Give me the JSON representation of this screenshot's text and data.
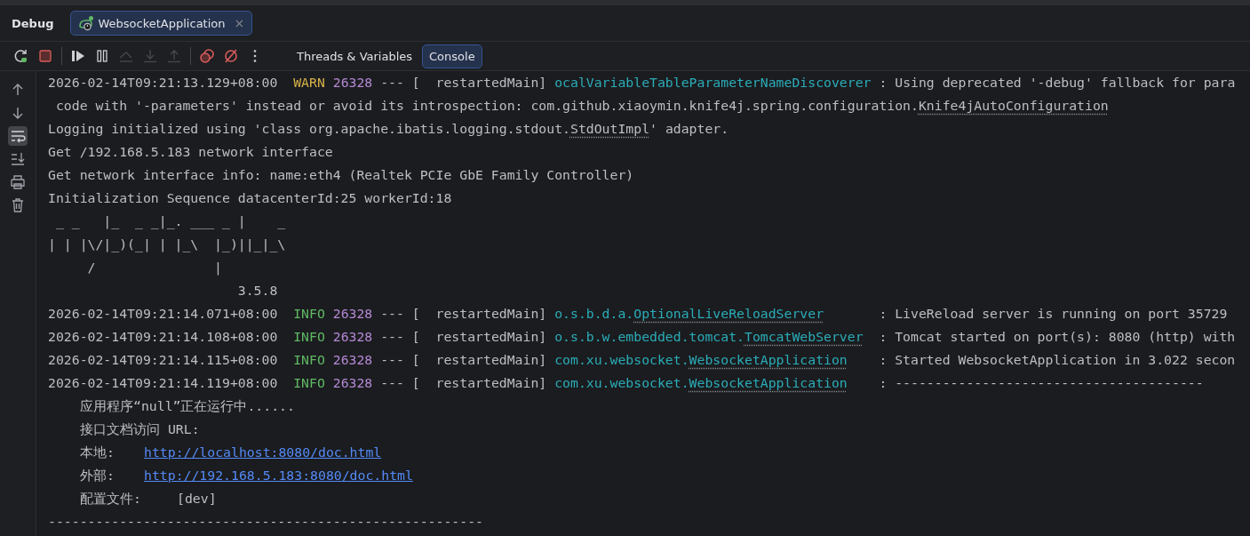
{
  "panel": {
    "title": "Debug",
    "session_tab": {
      "label": "WebsocketApplication",
      "close": "×",
      "selected": true
    }
  },
  "toolbar": {
    "buttons": [
      {
        "kind": "rerun",
        "disabled": false
      },
      {
        "kind": "stop",
        "disabled": false
      },
      {
        "kind": "resume",
        "disabled": false
      },
      {
        "kind": "pause",
        "disabled": false
      },
      {
        "kind": "step-over",
        "disabled": true
      },
      {
        "kind": "step-into",
        "disabled": true
      },
      {
        "kind": "step-out",
        "disabled": true
      },
      {
        "kind": "breakpoints",
        "disabled": false
      },
      {
        "kind": "mute",
        "disabled": false
      },
      {
        "kind": "more",
        "disabled": false
      }
    ],
    "tabs": [
      {
        "label": "Threads & Variables",
        "selected": false
      },
      {
        "label": "Console",
        "selected": true
      }
    ]
  },
  "gutter": [
    {
      "kind": "up",
      "on": false
    },
    {
      "kind": "down",
      "on": false
    },
    {
      "kind": "wrap",
      "on": true
    },
    {
      "kind": "scroll-end",
      "on": false
    },
    {
      "kind": "print",
      "on": false
    },
    {
      "kind": "clear",
      "on": false
    }
  ],
  "console": {
    "lines": [
      {
        "kind": "log",
        "time": "2026-02-14T09:21:13.129+08:00",
        "level": "WARN",
        "pid": "26328",
        "thread": "--- [  restartedMain]",
        "logger_package": "ocalVariableTableParameterNameDiscoverer",
        "message": ": Using deprecated '-debug' fallback for para"
      },
      {
        "kind": "text",
        "parts": [
          {
            "text": " code with '-parameters' instead or avoid its introspection: com.github.xiaoymin.knife4j.spring.configuration.",
            "underlined": false
          },
          {
            "text": "Knife4jAutoConfiguration",
            "underlined": true
          }
        ]
      },
      {
        "kind": "text",
        "parts": [
          {
            "text": "Logging initialized using 'class org.apache.ibatis.logging.stdout.",
            "underlined": false
          },
          {
            "text": "StdOutImpl",
            "underlined": true
          },
          {
            "text": "' adapter.",
            "underlined": false
          }
        ]
      },
      {
        "kind": "text",
        "parts": [
          {
            "text": "Get /192.168.5.183 network interface",
            "underlined": false
          }
        ]
      },
      {
        "kind": "text",
        "parts": [
          {
            "text": "Get network interface info: name:eth4 (Realtek PCIe GbE Family Controller)",
            "underlined": false
          }
        ]
      },
      {
        "kind": "text",
        "parts": [
          {
            "text": "Initialization Sequence datacenterId:25 workerId:18",
            "underlined": false
          }
        ]
      },
      {
        "kind": "banner",
        "text": " _ _   |_  _ _|_. ___ _ |    _"
      },
      {
        "kind": "banner",
        "text": "| | |\\/|_)(_| | |_\\  |_)||_|_\\"
      },
      {
        "kind": "banner",
        "text": "     /               |"
      },
      {
        "kind": "banner",
        "text": "                        3.5.8"
      },
      {
        "kind": "log",
        "time": "2026-02-14T09:21:14.071+08:00",
        "level": "INFO",
        "pid": "26328",
        "thread": "--- [  restartedMain]",
        "logger_package": "o.s.b.d.a.",
        "logger_class": "OptionalLiveReloadServer",
        "message": ": LiveReload server is running on port 35729"
      },
      {
        "kind": "log",
        "time": "2026-02-14T09:21:14.108+08:00",
        "level": "INFO",
        "pid": "26328",
        "thread": "--- [  restartedMain]",
        "logger_package": "o.s.b.w.embedded.tomcat.",
        "logger_class": "TomcatWebServer",
        "message": ": Tomcat started on port(s): 8080 (http) with"
      },
      {
        "kind": "log",
        "time": "2026-02-14T09:21:14.115+08:00",
        "level": "INFO",
        "pid": "26328",
        "thread": "--- [  restartedMain]",
        "logger_package": "com.xu.websocket.",
        "logger_class": "WebsocketApplication",
        "message": ": Started WebsocketApplication in 3.022 secon"
      },
      {
        "kind": "log",
        "time": "2026-02-14T09:21:14.119+08:00",
        "level": "INFO",
        "pid": "26328",
        "thread": "--- [  restartedMain]",
        "logger_package": "com.xu.websocket.",
        "logger_class": "WebsocketApplication",
        "message": ": ---------------------------------------"
      },
      {
        "kind": "note",
        "text": "应用程序“null”正在运行中......"
      },
      {
        "kind": "note",
        "text": "接口文档访问 URL:"
      },
      {
        "kind": "link",
        "label": "本地:",
        "url": "http://localhost:8080/doc.html"
      },
      {
        "kind": "link",
        "label": "外部:",
        "url": "http://192.168.5.183:8080/doc.html"
      },
      {
        "kind": "setting",
        "label": "配置文件:",
        "value": "[dev]"
      },
      {
        "kind": "rule",
        "text": "-------------------------------------------------------"
      }
    ]
  }
}
